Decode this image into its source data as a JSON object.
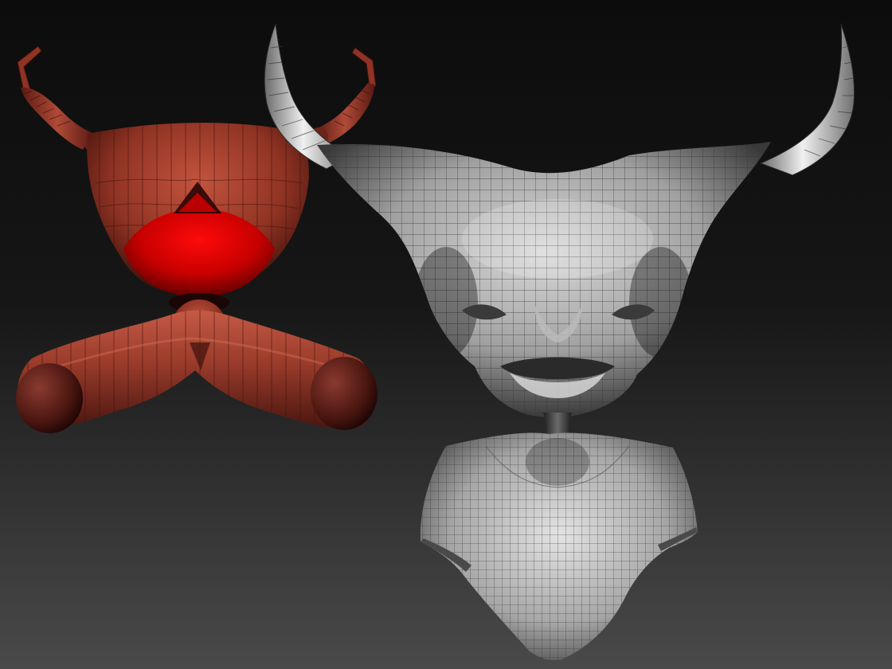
{
  "viewport": {
    "background_top": "#0c0c0c",
    "background_bottom": "#4a4a4a"
  },
  "models": [
    {
      "id": "zsphere-armature",
      "material": "red-clay",
      "colors": {
        "dark": "#4a1610",
        "base": "#8f3324",
        "mid": "#b04a38",
        "light": "#d86a55",
        "core": "#c80000",
        "core_dark": "#5a0000"
      }
    },
    {
      "id": "demon-bust-wireframe",
      "material": "gray-matcap-polyframe",
      "colors": {
        "dark": "#2a2a2a",
        "base": "#8c8c8c",
        "light": "#e6e6e6",
        "wire": "#3a3a3a"
      }
    }
  ]
}
